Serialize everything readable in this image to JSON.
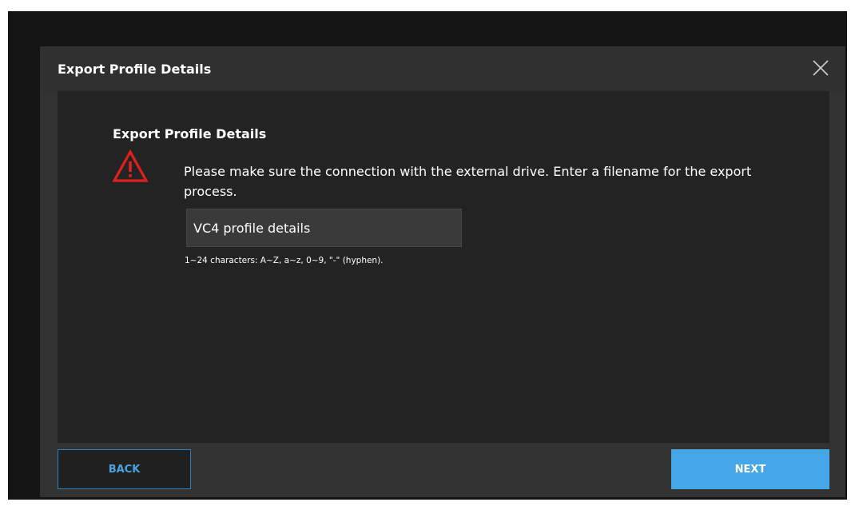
{
  "dialog": {
    "title": "Export Profile Details",
    "close_icon": "close-icon"
  },
  "content": {
    "heading": "Export Profile Details",
    "warning_icon": "warning-triangle-icon",
    "message": "Please make sure the connection with the external drive. Enter a filename for the export process.",
    "filename_value": "VC4 profile details",
    "hint": "1~24 characters: A~Z, a~z, 0~9, \"-\" (hyphen)."
  },
  "footer": {
    "back_label": "BACK",
    "next_label": "NEXT"
  },
  "colors": {
    "accent": "#45a6e8",
    "warning": "#e0201e"
  }
}
